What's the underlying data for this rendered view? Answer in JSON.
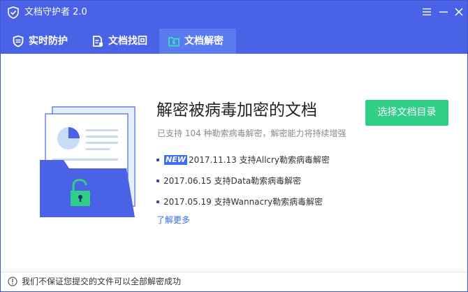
{
  "app": {
    "title": "文档守护者 2.0",
    "accent_color": "#4a63e6",
    "logo_icon": "shield-check-icon"
  },
  "window_controls": {
    "menu_icon": "menu-icon",
    "minimize_icon": "minimize-icon",
    "close_icon": "close-icon"
  },
  "tabs": [
    {
      "label": "实时防护",
      "icon": "shield-icon",
      "active": false
    },
    {
      "label": "文档找回",
      "icon": "document-restore-icon",
      "active": false
    },
    {
      "label": "文档解密",
      "icon": "unlock-folder-icon",
      "active": true
    }
  ],
  "main": {
    "title": "解密被病毒加密的文档",
    "subtitle": "已支持 104 种勒索病毒解密，解密能力将持续增强",
    "select_button_label": "选择文档目录",
    "select_button_color": "#2fcf86",
    "news": [
      {
        "badge": "NEW",
        "text": "2017.11.13 支持Allcry勒索病毒解密"
      },
      {
        "badge": "",
        "text": "2017.06.15 支持Data勒索病毒解密"
      },
      {
        "badge": "",
        "text": "2017.05.19 支持Wannacry勒索病毒解密"
      }
    ],
    "more_link": "了解更多",
    "link_color": "#2f6fe8"
  },
  "footer": {
    "icon": "info-icon",
    "text": "我们不保证您提交的文件可以全部解密成功"
  }
}
